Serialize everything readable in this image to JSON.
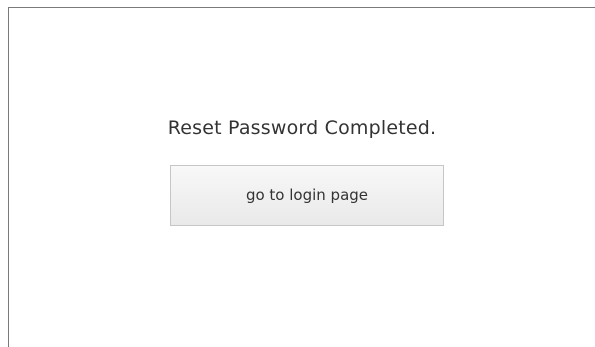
{
  "page": {
    "message": "Reset Password Completed.",
    "login_button_label": "go to login page"
  }
}
